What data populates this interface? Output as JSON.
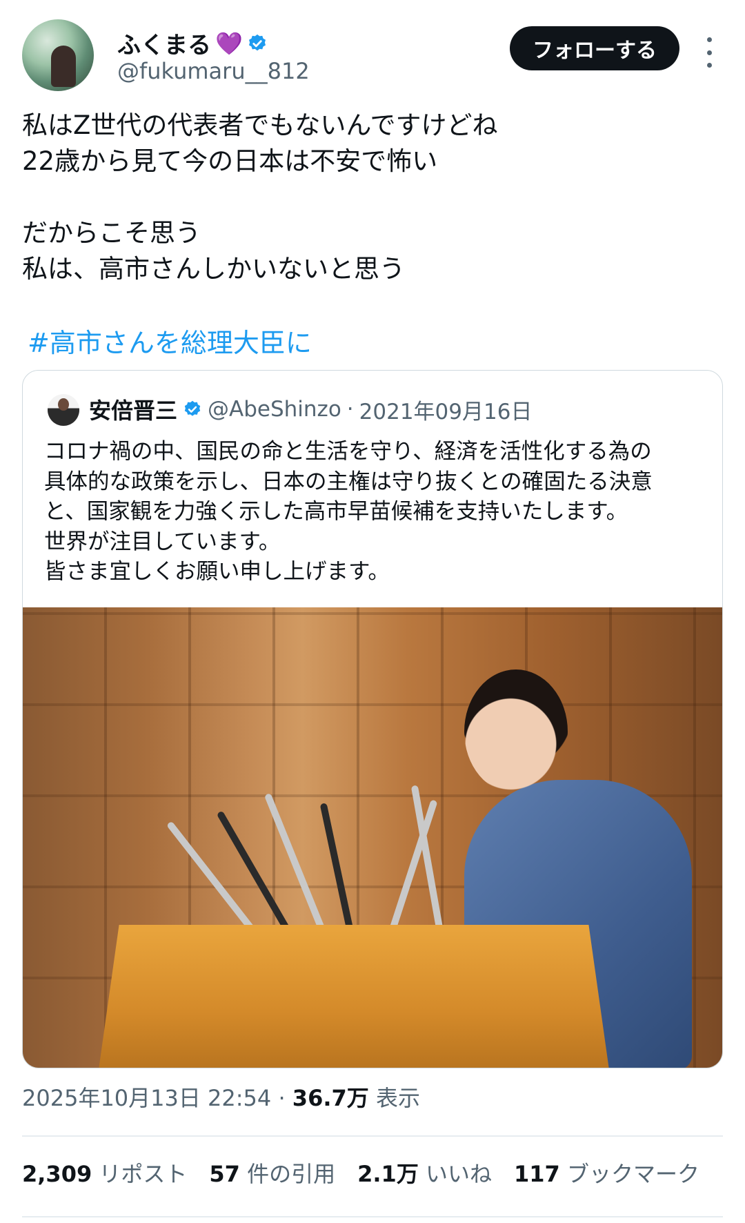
{
  "author": {
    "display_name": "ふくまる",
    "name_emoji": "💜",
    "handle": "@fukumaru__812",
    "verified_icon": "verified-badge-icon",
    "avatar_icon": "avatar"
  },
  "actions": {
    "follow_label": "フォローする",
    "more_icon": "more-vertical-icon"
  },
  "tweet": {
    "lines": [
      "私はZ世代の代表者でもないんですけどね",
      "22歳から見て今の日本は不安で怖い",
      "",
      "だからこそ思う",
      "私は、高市さんしかいないと思う"
    ],
    "hashtag": "#高市さんを総理大臣に"
  },
  "quote": {
    "name": "安倍晋三",
    "handle": "@AbeShinzo",
    "separator": "·",
    "date": "2021年09月16日",
    "lines": [
      "コロナ禍の中、国民の命と生活を守り、経済を活性化する為の",
      "具体的な政策を示し、日本の主権は守り抜くとの確固たる決意",
      "と、国家観を力強く示した高市早苗候補を支持いたします。",
      "世界が注目しています。",
      "皆さま宜しくお願い申し上げます。"
    ]
  },
  "meta": {
    "timestamp": "2025年10月13日 22:54",
    "separator": "·",
    "views_count": "36.7万",
    "views_label": "表示"
  },
  "stats": [
    {
      "count": "2,309",
      "label": "リポスト"
    },
    {
      "count": "57",
      "label": "件の引用"
    },
    {
      "count": "2.1万",
      "label": "いいね"
    },
    {
      "count": "117",
      "label": "ブックマーク"
    }
  ],
  "colors": {
    "accent": "#1d9bf0",
    "text": "#0f1419",
    "secondary": "#536471",
    "border": "#cfd9de"
  }
}
